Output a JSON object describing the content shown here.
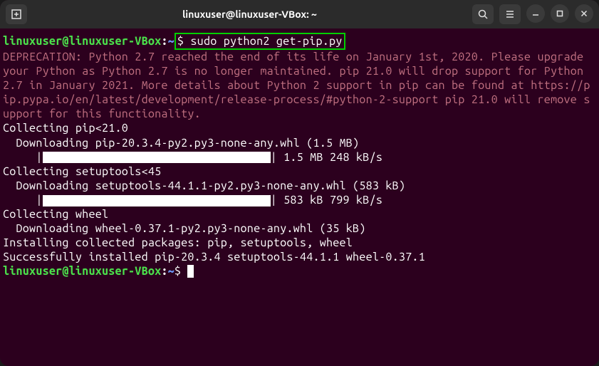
{
  "titlebar": {
    "title": "linuxuser@linuxuser-VBox: ~"
  },
  "prompt": {
    "user_host": "linuxuser@linuxuser-VBox",
    "path": "~",
    "symbol": "$"
  },
  "command": "sudo python2 get-pip.py",
  "deprecation": "DEPRECATION: Python 2.7 reached the end of its life on January 1st, 2020. Please upgrade your Python as Python 2.7 is no longer maintained. pip 21.0 will drop support for Python 2.7 in January 2021. More details about Python 2 support in pip can be found at https://pip.pypa.io/en/latest/development/release-process/#python-2-support pip 21.0 will remove support for this functionality.",
  "output": {
    "collecting_pip": "Collecting pip<21.0",
    "download_pip": "  Downloading pip-20.3.4-py2.py3-none-any.whl (1.5 MB)",
    "progress_pip_prefix": "     |",
    "progress_pip_suffix": "| 1.5 MB 248 kB/s",
    "collecting_setuptools": "Collecting setuptools<45",
    "download_setuptools": "  Downloading setuptools-44.1.1-py2.py3-none-any.whl (583 kB)",
    "progress_setup_prefix": "     |",
    "progress_setup_suffix": "| 583 kB 799 kB/s",
    "collecting_wheel": "Collecting wheel",
    "download_wheel": "  Downloading wheel-0.37.1-py2.py3-none-any.whl (35 kB)",
    "installing": "Installing collected packages: pip, setuptools, wheel",
    "success": "Successfully installed pip-20.3.4 setuptools-44.1.1 wheel-0.37.1"
  }
}
